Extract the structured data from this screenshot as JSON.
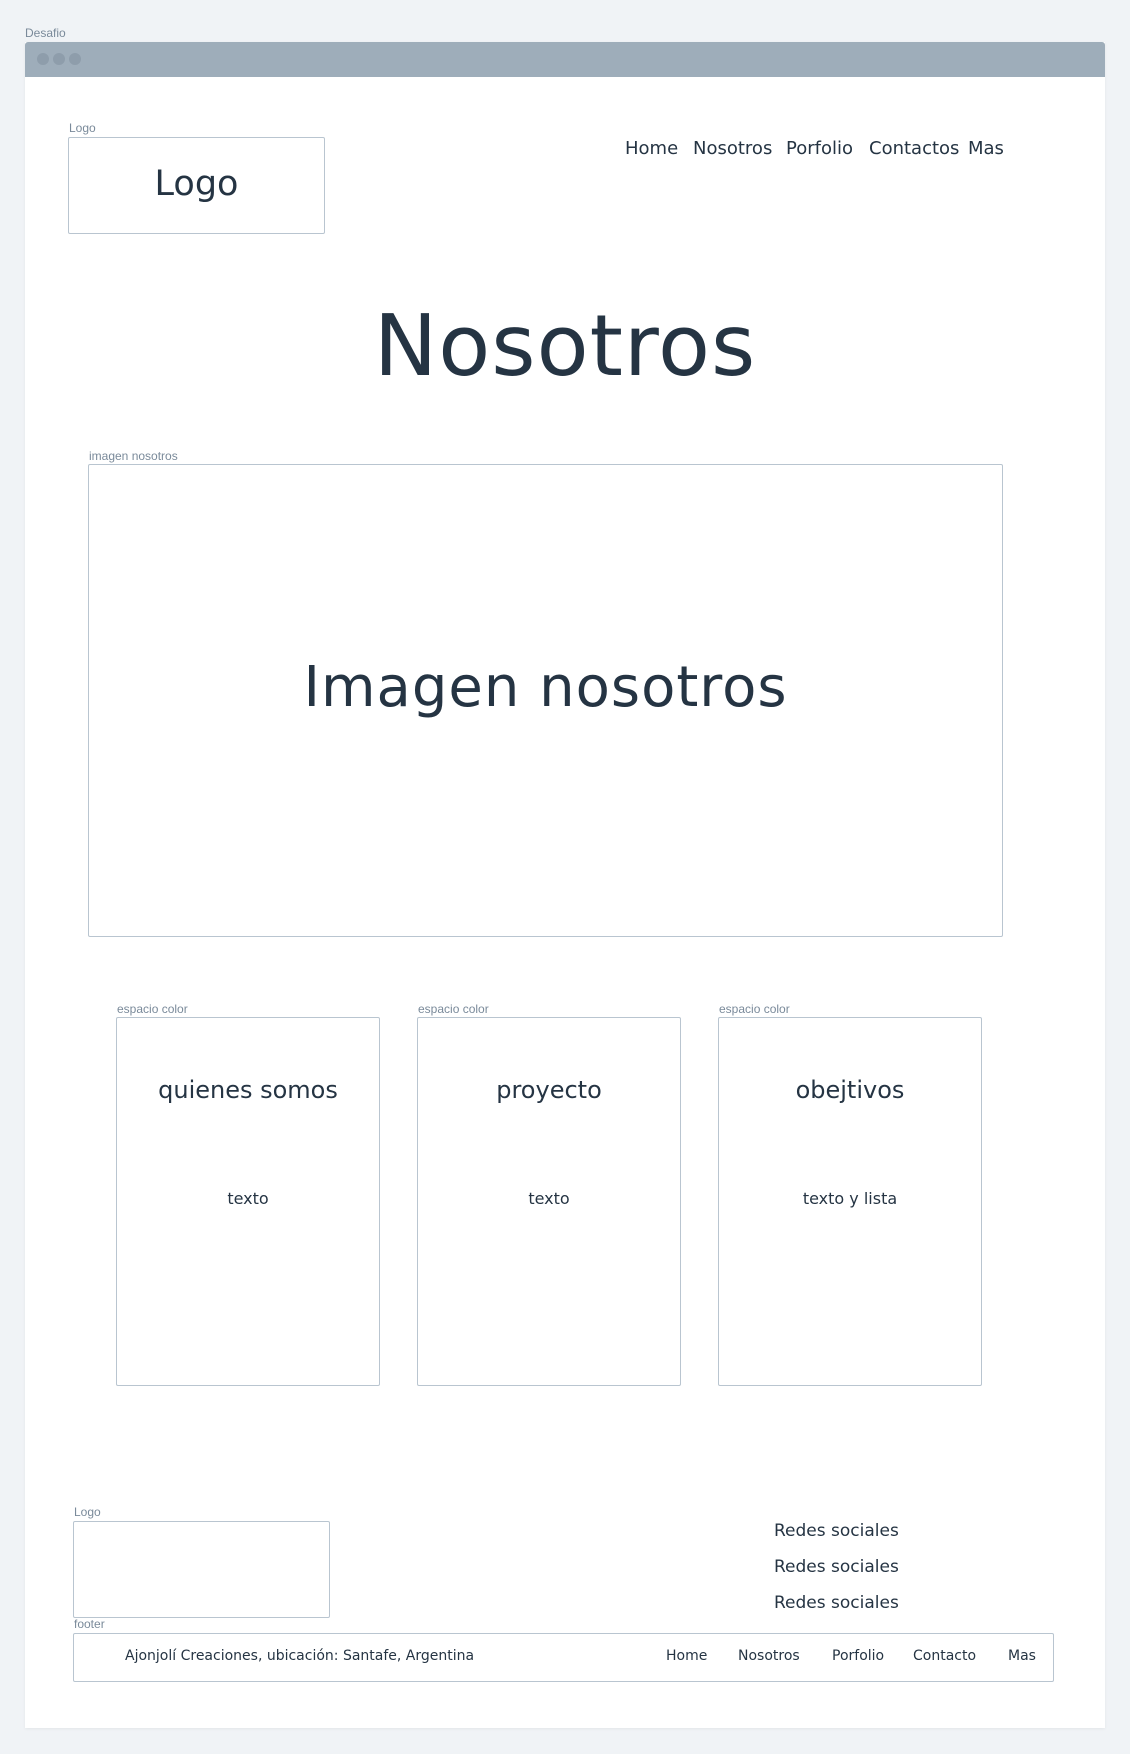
{
  "window": {
    "label": "Desafio"
  },
  "header": {
    "logo_label": "Logo",
    "logo_text": "Logo",
    "nav": [
      "Home",
      "Nosotros",
      "Porfolio",
      "Contactos",
      "Mas"
    ]
  },
  "main": {
    "title": "Nosotros",
    "image": {
      "label": "imagen nosotros",
      "text": "Imagen nosotros"
    },
    "cards": [
      {
        "label": "espacio color",
        "title": "quienes somos",
        "body": "texto"
      },
      {
        "label": "espacio color",
        "title": "proyecto",
        "body": "texto"
      },
      {
        "label": "espacio color",
        "title": "obejtivos",
        "body": "texto y lista"
      }
    ]
  },
  "footer": {
    "logo_label": "Logo",
    "social": [
      "Redes sociales",
      "Redes sociales",
      "Redes sociales"
    ],
    "label": "footer",
    "text": "Ajonjolí Creaciones, ubicación: Santafe, Argentina",
    "nav": [
      "Home",
      "Nosotros",
      "Porfolio",
      "Contacto",
      "Mas"
    ]
  }
}
